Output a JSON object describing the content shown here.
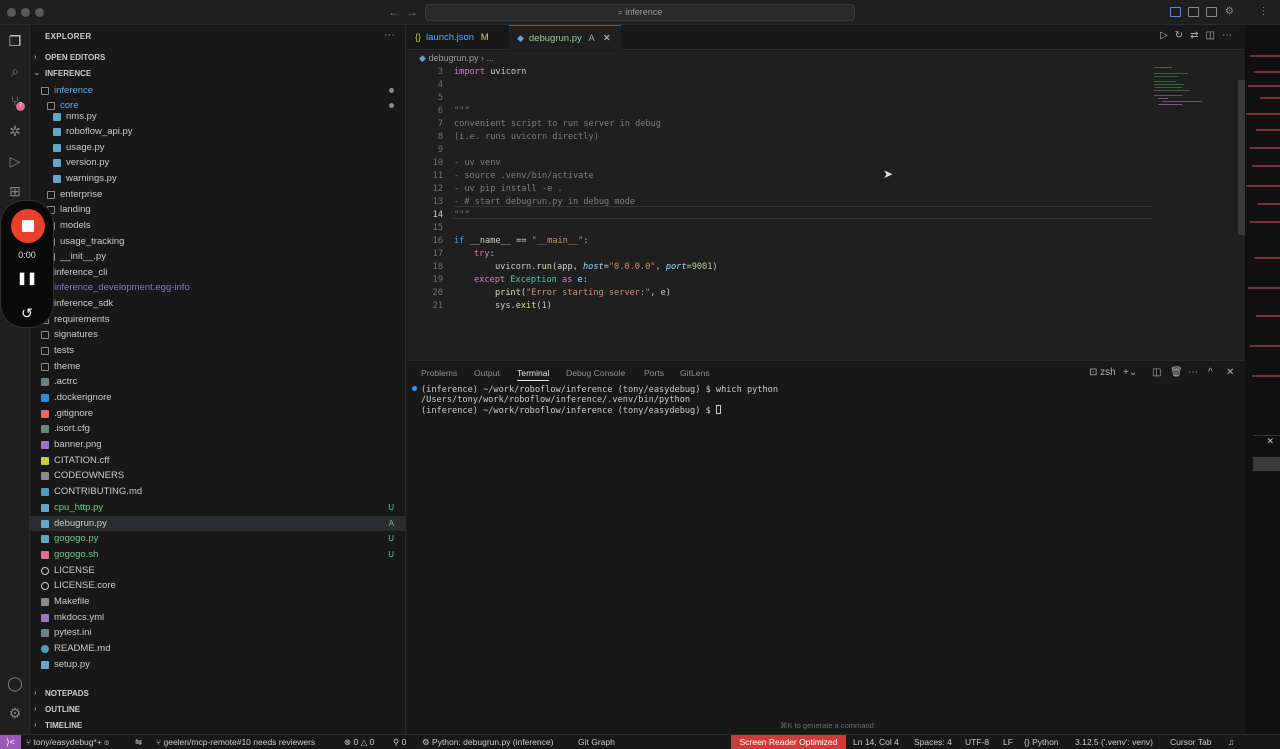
{
  "titlebar": {
    "search": "inference",
    "search_icon": "search-icon"
  },
  "sidebar": {
    "title": "EXPLORER",
    "more": "···",
    "sections": {
      "open_editors": "OPEN EDITORS",
      "project": "INFERENCE",
      "notepads": "NOTEPADS",
      "outline": "OUTLINE",
      "timeline": "TIMELINE"
    },
    "tree": [
      {
        "name": "inference",
        "status": ""
      },
      {
        "name": "core",
        "status": ""
      },
      {
        "name": "nms.py",
        "status": ""
      },
      {
        "name": "roboflow_api.py",
        "status": ""
      },
      {
        "name": "usage.py",
        "status": ""
      },
      {
        "name": "version.py",
        "status": ""
      },
      {
        "name": "warnings.py",
        "status": ""
      },
      {
        "name": "enterprise",
        "status": ""
      },
      {
        "name": "landing",
        "status": ""
      },
      {
        "name": "models",
        "status": ""
      },
      {
        "name": "usage_tracking",
        "status": ""
      },
      {
        "name": "__init__.py",
        "status": ""
      },
      {
        "name": "inference_cli",
        "status": ""
      },
      {
        "name": "inference_development.egg-info",
        "status": ""
      },
      {
        "name": "inference_sdk",
        "status": ""
      },
      {
        "name": "requirements",
        "status": ""
      },
      {
        "name": "signatures",
        "status": ""
      },
      {
        "name": "tests",
        "status": ""
      },
      {
        "name": "theme",
        "status": ""
      },
      {
        "name": ".actrc",
        "status": ""
      },
      {
        "name": ".dockerignore",
        "status": ""
      },
      {
        "name": ".gitignore",
        "status": ""
      },
      {
        "name": ".isort.cfg",
        "status": ""
      },
      {
        "name": "banner.png",
        "status": ""
      },
      {
        "name": "CITATION.cff",
        "status": ""
      },
      {
        "name": "CODEOWNERS",
        "status": ""
      },
      {
        "name": "CONTRIBUTING.md",
        "status": ""
      },
      {
        "name": "cpu_http.py",
        "status": "U"
      },
      {
        "name": "debugrun.py",
        "status": "A"
      },
      {
        "name": "gogogo.py",
        "status": "U"
      },
      {
        "name": "gogogo.sh",
        "status": "U"
      },
      {
        "name": "LICENSE",
        "status": ""
      },
      {
        "name": "LICENSE.core",
        "status": ""
      },
      {
        "name": "Makefile",
        "status": ""
      },
      {
        "name": "mkdocs.yml",
        "status": ""
      },
      {
        "name": "pytest.ini",
        "status": ""
      },
      {
        "name": "README.md",
        "status": ""
      },
      {
        "name": "setup.py",
        "status": ""
      }
    ]
  },
  "recorder": {
    "time": "0:00"
  },
  "tabs": [
    {
      "label": "launch.json",
      "status": "M",
      "icon": "json-icon"
    },
    {
      "label": "debugrun.py",
      "status": "A",
      "icon": "python-icon"
    }
  ],
  "breadcrumb": {
    "file": "debugrun.py",
    "more": "..."
  },
  "editor": {
    "lines": [
      {
        "n": "3",
        "t": ""
      },
      {
        "n": "4",
        "t": ""
      },
      {
        "n": "5",
        "t": ""
      },
      {
        "n": "6",
        "t": ""
      },
      {
        "n": "7",
        "t": ""
      },
      {
        "n": "8",
        "t": ""
      },
      {
        "n": "9",
        "t": ""
      },
      {
        "n": "10",
        "t": ""
      },
      {
        "n": "11",
        "t": ""
      },
      {
        "n": "12",
        "t": ""
      },
      {
        "n": "13",
        "t": ""
      },
      {
        "n": "14",
        "t": ""
      },
      {
        "n": "15",
        "t": ""
      },
      {
        "n": "16",
        "t": ""
      },
      {
        "n": "17",
        "t": ""
      },
      {
        "n": "18",
        "t": ""
      },
      {
        "n": "19",
        "t": ""
      },
      {
        "n": "20",
        "t": ""
      },
      {
        "n": "21",
        "t": ""
      }
    ],
    "code": {
      "l3a": "import",
      "l3b": " uvicorn",
      "l6": "\"\"\"",
      "l7": "convenient script to run server in debug",
      "l8": "(i.e. runs uvicorn directly)",
      "l10": "- uv venv",
      "l11": "- source .venv/bin/activate",
      "l12": "- uv pip install -e .",
      "l13": "- # start debugrun.py in debug mode",
      "l14": "\"\"\"",
      "l16a": "if",
      "l16b": " __name__ == ",
      "l16c": "\"__main__\"",
      "l16d": ":",
      "l17a": "try",
      "l17b": ":",
      "l18a": "uvicorn.",
      "l18b": "run",
      "l18c": "(app, ",
      "l18d": "host",
      "l18e": "=",
      "l18f": "\"0.0.0.0\"",
      "l18g": ", ",
      "l18h": "port",
      "l18i": "=",
      "l18j": "9001",
      "l18k": ")",
      "l19a": "except",
      "l19b": " Exception",
      "l19c": " as ",
      "l19d": "e",
      "l19e": ":",
      "l20a": "print",
      "l20b": "(",
      "l20c": "\"Error starting server:\"",
      "l20d": ", e)",
      "l21a": "sys.",
      "l21b": "exit",
      "l21c": "(",
      "l21d": "1",
      "l21e": ")"
    }
  },
  "panel": {
    "tabs": [
      "Problems",
      "Output",
      "Terminal",
      "Debug Console",
      "Ports",
      "GitLens"
    ],
    "active": "Terminal",
    "shell": "zsh",
    "terminal": [
      "(inference) ~/work/roboflow/inference (tony/easydebug) $ which python",
      "/Users/tony/work/roboflow/inference/.venv/bin/python",
      "(inference) ~/work/roboflow/inference (tony/easydebug) $ "
    ],
    "hint": "⌘K to generate a command"
  },
  "statusbar": {
    "remote": "⟩<",
    "branch": "tony/easydebug*+",
    "pr": "geelen/mcp-remote#10 needs reviewers",
    "errors": "0",
    "warnings": "0",
    "info": "0",
    "ports": "0",
    "python": "Python: debugrun.py (inference)",
    "gitgraph": "Git Graph",
    "screen_reader": "Screen Reader Optimized",
    "position": "Ln 14, Col 4",
    "spaces": "Spaces: 4",
    "encoding": "UTF-8",
    "eol": "LF",
    "language": "Python",
    "interpreter": "3.12.5 ('.venv': venv)",
    "cursor_tab": "Cursor Tab"
  },
  "colors": {
    "accent": "#0078d4",
    "untracked": "#73c991",
    "added": "#81b88b",
    "record": "#e8412d",
    "screen_reader": "#d03a3a"
  }
}
